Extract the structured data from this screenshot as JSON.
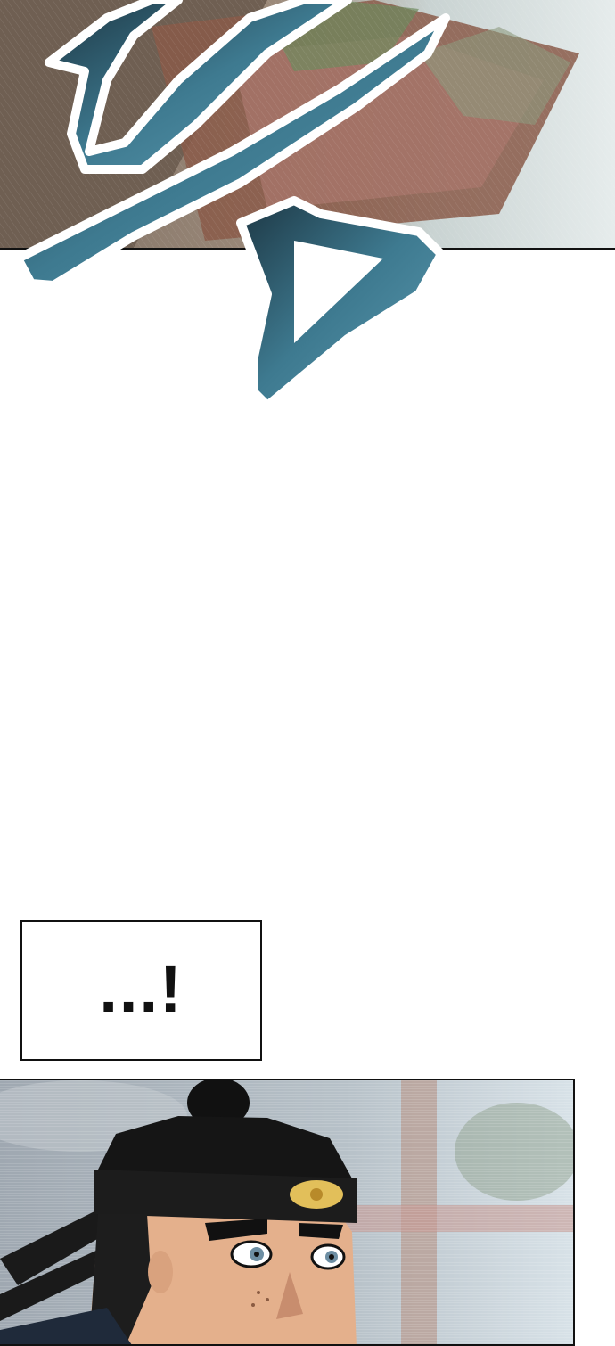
{
  "panels": [
    {
      "name": "top-panel",
      "scene": "blurred-courtyard-pavilion"
    },
    {
      "name": "bottom-panel",
      "scene": "man-with-headband-closeup"
    }
  ],
  "sound_effect": {
    "style": "brush-stroke",
    "color": "#2f5f72"
  },
  "caption": {
    "text": "...!"
  },
  "colors": {
    "sfx_dark": "#1f3d4c",
    "sfx_light": "#5c9ab0",
    "panel_border": "#111111",
    "headband_ornament": "#e2bf5a"
  }
}
